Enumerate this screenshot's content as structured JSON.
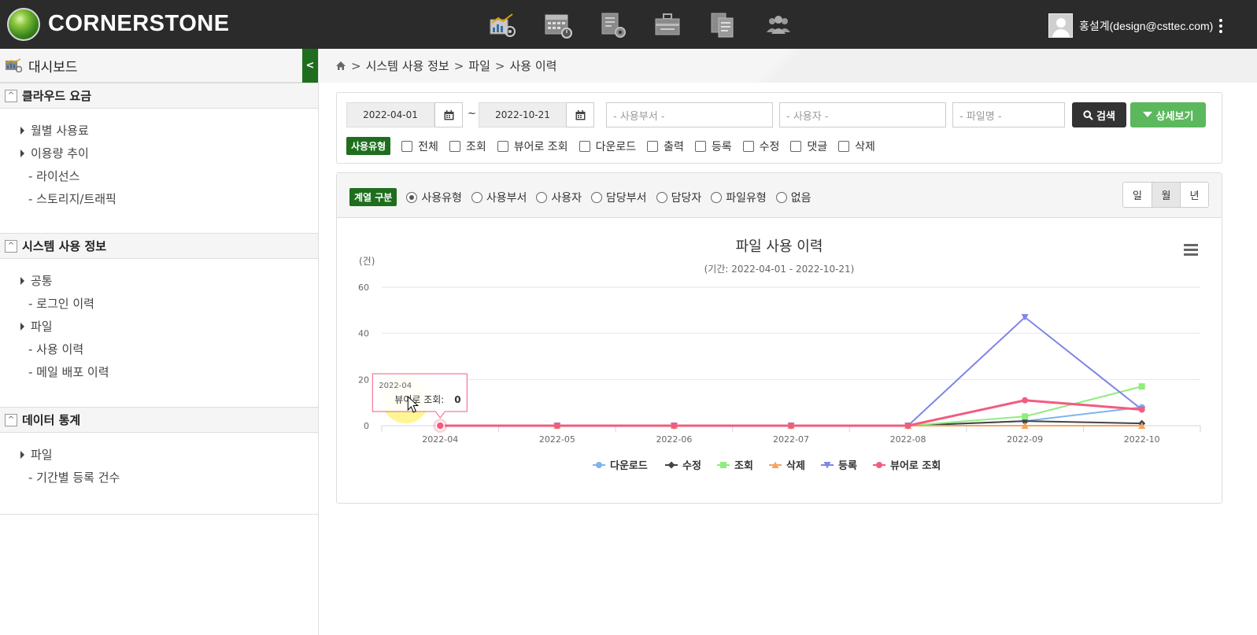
{
  "app": {
    "logo_text": "CORNERSTONE",
    "top_icons": [
      "usage-chart-icon",
      "calendar-clock-icon",
      "document-settings-icon",
      "briefcase-icon",
      "documents-list-icon",
      "group-users-icon"
    ],
    "user_name": "홍설계(design@csttec.com)"
  },
  "sidebar": {
    "dashboard_label": "대시보드",
    "sections": [
      {
        "title": "클라우드 요금",
        "items": [
          {
            "label": "월별 사용료",
            "type": "expand"
          },
          {
            "label": "이용량 추이",
            "type": "expand"
          },
          {
            "label": "- 라이선스",
            "type": "leaf"
          },
          {
            "label": "- 스토리지/트래픽",
            "type": "leaf"
          }
        ]
      },
      {
        "title": "시스템 사용 정보",
        "items": [
          {
            "label": "공통",
            "type": "expand"
          },
          {
            "label": "- 로그인 이력",
            "type": "leaf"
          },
          {
            "label": "파일",
            "type": "expand"
          },
          {
            "label": "- 사용 이력",
            "type": "leaf"
          },
          {
            "label": "- 메일 배포 이력",
            "type": "leaf"
          }
        ]
      },
      {
        "title": "데이터 통계",
        "items": [
          {
            "label": "파일",
            "type": "expand"
          },
          {
            "label": "- 기간별 등록 건수",
            "type": "leaf"
          }
        ]
      }
    ]
  },
  "breadcrumb": {
    "items": [
      "시스템 사용 정보",
      "파일",
      "사용 이력"
    ]
  },
  "filters": {
    "date_from": "2022-04-01",
    "date_to": "2022-10-21",
    "tilde": "~",
    "dept_placeholder": "- 사용부서 -",
    "user_placeholder": "- 사용자 -",
    "file_placeholder": "- 파일명 -",
    "search_label": "검색",
    "detail_label": "상세보기",
    "usage_type_label": "사용유형",
    "usage_types": [
      "전체",
      "조회",
      "뷰어로 조회",
      "다운로드",
      "출력",
      "등록",
      "수정",
      "댓글",
      "삭제"
    ]
  },
  "series_options": {
    "label": "계열 구분",
    "options": [
      "사용유형",
      "사용부서",
      "사용자",
      "담당부서",
      "담당자",
      "파일유형",
      "없음"
    ],
    "selected": "사용유형"
  },
  "period_buttons": {
    "items": [
      "일",
      "월",
      "년"
    ],
    "active": "월"
  },
  "chart_data": {
    "type": "line",
    "title": "파일 사용 이력",
    "subtitle": "(기간: 2022-04-01 - 2022-10-21)",
    "ylabel": "(건)",
    "ylim": [
      0,
      60
    ],
    "yticks": [
      0,
      20,
      40,
      60
    ],
    "categories": [
      "2022-04",
      "2022-05",
      "2022-06",
      "2022-07",
      "2022-08",
      "2022-09",
      "2022-10"
    ],
    "legend_position": "bottom-center",
    "grid": true,
    "series": [
      {
        "name": "다운로드",
        "color": "#7cb5ec",
        "marker": "circle",
        "values": [
          0,
          0,
          0,
          0,
          0,
          2,
          8
        ]
      },
      {
        "name": "수정",
        "color": "#434348",
        "marker": "diamond",
        "values": [
          0,
          0,
          0,
          0,
          0,
          2,
          1
        ]
      },
      {
        "name": "조회",
        "color": "#90ed7d",
        "marker": "square",
        "values": [
          0,
          0,
          0,
          0,
          0,
          4,
          17
        ]
      },
      {
        "name": "삭제",
        "color": "#f7a35c",
        "marker": "triangle",
        "values": [
          0,
          0,
          0,
          0,
          0,
          0,
          0
        ]
      },
      {
        "name": "등록",
        "color": "#8085e9",
        "marker": "triangle-down",
        "values": [
          0,
          0,
          0,
          0,
          0,
          47,
          7
        ]
      },
      {
        "name": "뷰어로 조회",
        "color": "#f15c80",
        "marker": "circle",
        "values": [
          0,
          0,
          0,
          0,
          0,
          11,
          7
        ]
      }
    ],
    "tooltip": {
      "category": "2022-04",
      "series": "뷰어로 조회",
      "value": 0
    }
  }
}
